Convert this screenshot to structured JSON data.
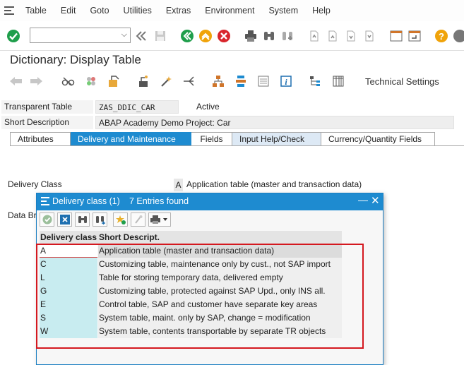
{
  "menubar": {
    "items": [
      "Table",
      "Edit",
      "Goto",
      "Utilities",
      "Extras",
      "Environment",
      "System",
      "Help"
    ]
  },
  "page": {
    "title": "Dictionary: Display Table"
  },
  "toolbar2": {
    "technical_settings": "Technical Settings"
  },
  "header": {
    "transparent_table_label": "Transparent Table",
    "table_name": "ZAS_DDIC_CAR",
    "status": "Active",
    "short_description_label": "Short Description",
    "short_description": "ABAP Academy Demo Project: Car"
  },
  "tabs": [
    "Attributes",
    "Delivery and Maintenance",
    "Fields",
    "Input Help/Check",
    "Currency/Quantity Fields"
  ],
  "form": {
    "delivery_class_label": "Delivery Class",
    "delivery_class_value": "A",
    "delivery_class_text": "Application table (master and transaction data)",
    "data_browser_label": "Data Br"
  },
  "popup": {
    "title": "Delivery class (1)",
    "entries": "7 Entries found",
    "col_code": "Delivery class",
    "col_text": "Short Descript.",
    "rows": [
      {
        "code": "A",
        "text": "Application table (master and transaction data)"
      },
      {
        "code": "C",
        "text": "Customizing table, maintenance only by cust., not SAP import"
      },
      {
        "code": "L",
        "text": "Table for storing temporary data, delivered empty"
      },
      {
        "code": "G",
        "text": "Customizing table, protected against SAP Upd., only INS all."
      },
      {
        "code": "E",
        "text": "Control table, SAP and customer have separate key areas"
      },
      {
        "code": "S",
        "text": "System table, maint. only by SAP, change = modification"
      },
      {
        "code": "W",
        "text": "System table, contents transportable by separate TR objects"
      }
    ]
  },
  "colors": {
    "accent": "#1e8bd0",
    "highlight_box": "#d4181f",
    "code_column": "#c8ecf0"
  }
}
